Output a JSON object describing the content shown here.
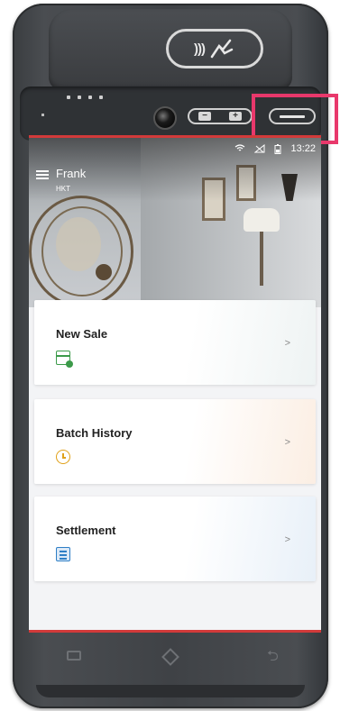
{
  "status_bar": {
    "time": "13:22",
    "wifi": "wifi-icon",
    "signal": "no-signal-icon",
    "battery": "battery-icon"
  },
  "header": {
    "user_name": "Frank",
    "user_subtitle": "HKT"
  },
  "cards": [
    {
      "title": "New Sale",
      "icon": "sale-icon",
      "chevron": ">"
    },
    {
      "title": "Batch History",
      "icon": "clock-icon",
      "chevron": ">"
    },
    {
      "title": "Settlement",
      "icon": "receipt-icon",
      "chevron": ">"
    }
  ],
  "device": {
    "nfc_symbol": ")))",
    "highlight_color": "#e8386b",
    "accent_bar_color": "#d23a3a"
  }
}
